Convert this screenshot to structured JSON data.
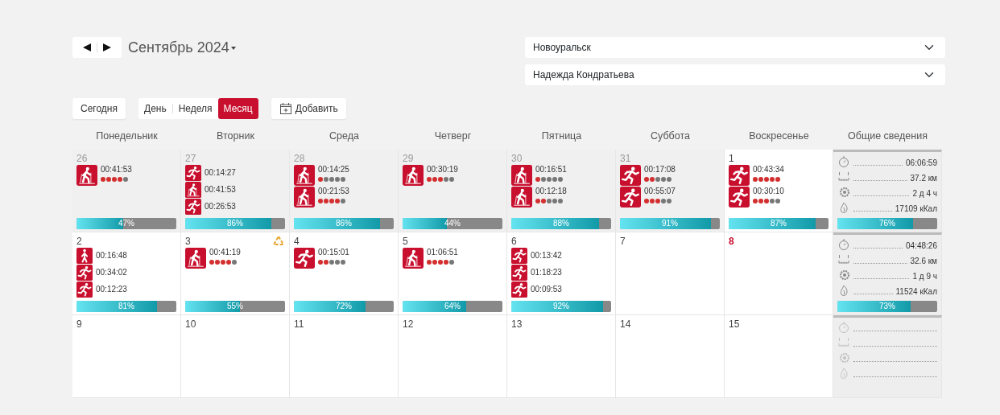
{
  "period": {
    "title": "Сентябрь 2024"
  },
  "filters": [
    {
      "value": "Новоуральск"
    },
    {
      "value": "Надежда Кондратьева"
    }
  ],
  "today_button": "Сегодня",
  "views": [
    {
      "label": "День",
      "selected": false
    },
    {
      "label": "Неделя",
      "selected": false
    },
    {
      "label": "Месяц",
      "selected": true
    }
  ],
  "add_button": "Добавить",
  "weekdays": [
    "Понедельник",
    "Вторник",
    "Среда",
    "Четверг",
    "Пятница",
    "Суббота",
    "Воскресенье",
    "Общие сведения"
  ],
  "weeks": [
    {
      "days": [
        {
          "number": "26",
          "other_month": true,
          "holiday": false,
          "alert": false,
          "entries": [
            {
              "kind": "ski",
              "time": "00:41:53",
              "stars": 4
            }
          ],
          "level": 0.47,
          "percent": "47%"
        },
        {
          "number": "27",
          "other_month": true,
          "holiday": false,
          "alert": false,
          "entries": [
            {
              "kind": "run",
              "time": "00:14:27"
            },
            {
              "kind": "ski",
              "time": "00:41:53"
            },
            {
              "kind": "run",
              "time": "00:26:53"
            }
          ],
          "level": 0.86,
          "percent": "86%"
        },
        {
          "number": "28",
          "other_month": true,
          "holiday": false,
          "alert": false,
          "entries": [
            {
              "kind": "ski",
              "time": "00:14:25",
              "stars": 1
            },
            {
              "kind": "ski",
              "time": "00:21:53",
              "stars": 4
            }
          ],
          "level": 0.86,
          "percent": "86%"
        },
        {
          "number": "29",
          "other_month": true,
          "holiday": false,
          "alert": false,
          "entries": [
            {
              "kind": "ski",
              "time": "00:30:19",
              "stars": 3
            }
          ],
          "level": 0.44,
          "percent": "44%"
        },
        {
          "number": "30",
          "other_month": true,
          "holiday": false,
          "alert": false,
          "entries": [
            {
              "kind": "ski",
              "time": "00:16:51",
              "stars": 1
            },
            {
              "kind": "ski",
              "time": "00:12:18",
              "stars": 2
            }
          ],
          "level": 0.88,
          "percent": "88%"
        },
        {
          "number": "31",
          "other_month": true,
          "holiday": false,
          "alert": false,
          "entries": [
            {
              "kind": "run",
              "time": "00:17:08",
              "stars": 2
            },
            {
              "kind": "run",
              "time": "00:55:07",
              "stars": 3
            }
          ],
          "level": 0.91,
          "percent": "91%"
        },
        {
          "number": "1",
          "other_month": false,
          "holiday": false,
          "alert": false,
          "entries": [
            {
              "kind": "run",
              "time": "00:43:34",
              "stars": 5
            },
            {
              "kind": "run",
              "time": "00:30:10",
              "stars": 3
            }
          ],
          "level": 0.87,
          "percent": "87%"
        }
      ],
      "summary": {
        "stats": [
          {
            "kind": "time",
            "value": "06:06:59"
          },
          {
            "kind": "distance",
            "value": "37.2 км"
          },
          {
            "kind": "duration",
            "value": "2 д 4 ч"
          },
          {
            "kind": "calories",
            "value": "17109 кКал"
          }
        ],
        "level": 0.76,
        "percent": "76%"
      }
    },
    {
      "days": [
        {
          "number": "2",
          "other_month": false,
          "holiday": false,
          "alert": false,
          "entries": [
            {
              "kind": "walk",
              "time": "00:16:48"
            },
            {
              "kind": "run",
              "time": "00:34:02"
            },
            {
              "kind": "run",
              "time": "00:12:23"
            }
          ],
          "level": 0.81,
          "percent": "81%"
        },
        {
          "number": "3",
          "other_month": false,
          "holiday": false,
          "alert": true,
          "entries": [
            {
              "kind": "ski",
              "time": "00:41:19",
              "stars": 4
            }
          ],
          "level": 0.55,
          "percent": "55%"
        },
        {
          "number": "4",
          "other_month": false,
          "holiday": false,
          "alert": false,
          "entries": [
            {
              "kind": "run",
              "time": "00:15:01",
              "stars": 2
            }
          ],
          "level": 0.72,
          "percent": "72%"
        },
        {
          "number": "5",
          "other_month": false,
          "holiday": false,
          "alert": false,
          "entries": [
            {
              "kind": "ski",
              "time": "01:06:51",
              "stars": 4
            }
          ],
          "level": 0.64,
          "percent": "64%"
        },
        {
          "number": "6",
          "other_month": false,
          "holiday": false,
          "alert": false,
          "entries": [
            {
              "kind": "run",
              "time": "00:13:42"
            },
            {
              "kind": "run",
              "time": "01:18:23"
            },
            {
              "kind": "run",
              "time": "00:09:53"
            }
          ],
          "level": 0.92,
          "percent": "92%"
        },
        {
          "number": "7",
          "other_month": false,
          "holiday": false,
          "alert": false
        },
        {
          "number": "8",
          "other_month": false,
          "holiday": true,
          "alert": false
        }
      ],
      "summary": {
        "stats": [
          {
            "kind": "time",
            "value": "04:48:26"
          },
          {
            "kind": "distance",
            "value": "32.6 км"
          },
          {
            "kind": "duration",
            "value": "1 д 9 ч"
          },
          {
            "kind": "calories",
            "value": "11524 кКал"
          }
        ],
        "level": 0.73,
        "percent": "73%"
      }
    },
    {
      "days": [
        {
          "number": "9",
          "other_month": false,
          "holiday": false,
          "alert": false
        },
        {
          "number": "10",
          "other_month": false,
          "holiday": false,
          "alert": false
        },
        {
          "number": "11",
          "other_month": false,
          "holiday": false,
          "alert": false
        },
        {
          "number": "12",
          "other_month": false,
          "holiday": false,
          "alert": false
        },
        {
          "number": "13",
          "other_month": false,
          "holiday": false,
          "alert": false
        },
        {
          "number": "14",
          "other_month": false,
          "holiday": false,
          "alert": false
        },
        {
          "number": "15",
          "other_month": false,
          "holiday": false,
          "alert": false
        }
      ],
      "summary": {
        "stats": [
          {
            "kind": "time"
          },
          {
            "kind": "distance"
          },
          {
            "kind": "duration"
          },
          {
            "kind": "calories"
          }
        ]
      }
    }
  ]
}
